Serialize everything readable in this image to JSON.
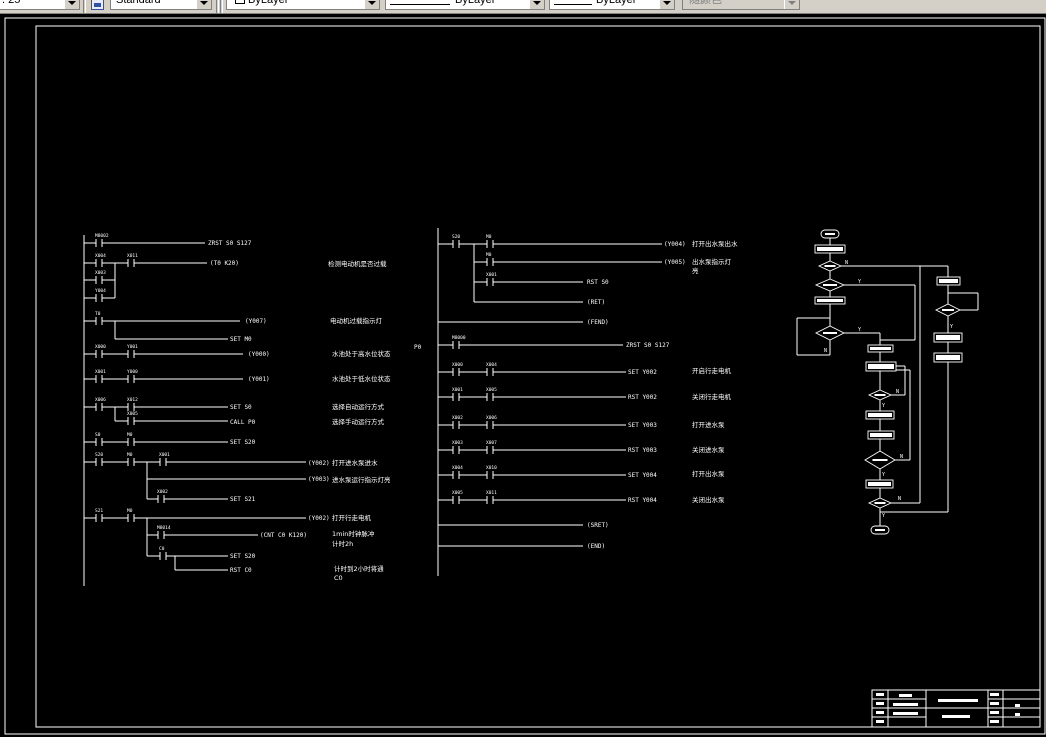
{
  "toolbar": {
    "scale_value": ". 25",
    "text_style": "Standard",
    "layer": "ByLayer",
    "linetype": "ByLayer",
    "lineweight": "ByLayer",
    "plot_style": "随颜色"
  },
  "colors": {
    "drawing_background": "#000000",
    "linework": "#ffffff",
    "toolbar_face": "#d4d0c8"
  },
  "icons": {
    "text_style_icon": "text-style-icon",
    "dropdown_arrow": "chevron-down-icon"
  },
  "ladder_left": {
    "contacts": [
      "M8002",
      "X004",
      "X011",
      "X003",
      "Y004",
      "T0",
      "X000",
      "Y001",
      "X001",
      "Y000",
      "X006",
      "X012",
      "X005",
      "S0",
      "M0",
      "S20",
      "M0",
      "X001",
      "X002",
      "S21",
      "M0",
      "M8014",
      "C0"
    ],
    "outputs": [
      "ZRST S0 S127",
      "(T0 K20)",
      "(Y007)",
      "SET M0",
      "(Y000)",
      "(Y001)",
      "SET S0",
      "CALL P0",
      "SET S20",
      "(Y002)",
      "(Y003)",
      "SET S21",
      "(Y002)",
      "(CNT C0 K120)",
      "SET S20",
      "RST C0"
    ],
    "comments": [
      "检测电动机是否过载",
      "电动机过载指示灯",
      "水池处于高水位状态",
      "水池处于低水位状态",
      "选择自动运行方式",
      "选择手动运行方式",
      "打开进水泵进水",
      "进水泵运行指示灯亮",
      "打开行走电机",
      "1min时钟脉冲",
      "计时2h",
      "计时到2小时将通",
      "C0"
    ]
  },
  "ladder_right": {
    "pointer": "P0",
    "contacts": [
      "S20",
      "M0",
      "M0",
      "X001",
      "M8000",
      "X000",
      "X004",
      "X001",
      "X005",
      "X002",
      "X006",
      "X003",
      "X007",
      "X004",
      "X010",
      "X005",
      "X011"
    ],
    "outputs": [
      "(Y004)",
      "(Y005)",
      "RST S0",
      "(RET)",
      "(FEND)",
      "ZRST S0 S127",
      "SET Y002",
      "RST Y002",
      "SET Y003",
      "RST Y003",
      "SET Y004",
      "RST Y004",
      "(SRET)",
      "(END)"
    ],
    "comments": [
      "打开出水泵出水",
      "出水泵指示灯",
      "亮",
      "开启行走电机",
      "关闭行走电机",
      "打开进水泵",
      "关闭进水泵",
      "打开出水泵",
      "关闭出水泵"
    ]
  },
  "flowchart": {
    "labels": [
      "N",
      "Y",
      "Y",
      "N",
      "N",
      "Y",
      "N",
      "Y",
      "N",
      "Y",
      "Y"
    ]
  }
}
